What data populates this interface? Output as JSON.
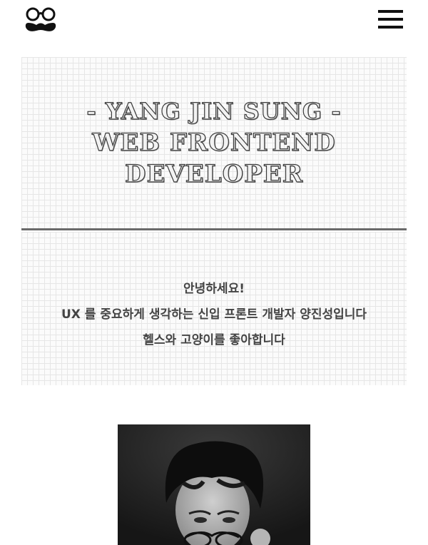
{
  "header": {
    "logo_icon": "glasses-mustache-logo",
    "menu_icon": "hamburger-menu-icon"
  },
  "hero": {
    "line1": "- YANG JIN SUNG -",
    "line2": "WEB FRONTEND",
    "line3": "DEVELOPER"
  },
  "intro": {
    "line1": "안녕하세요!",
    "line2": "UX 를 중요하게 생각하는 신입 프론트 개발자 양진성입니다",
    "line3": "헬스와 고양이를 좋아합니다"
  },
  "profile": {
    "image": "profile-photo"
  }
}
